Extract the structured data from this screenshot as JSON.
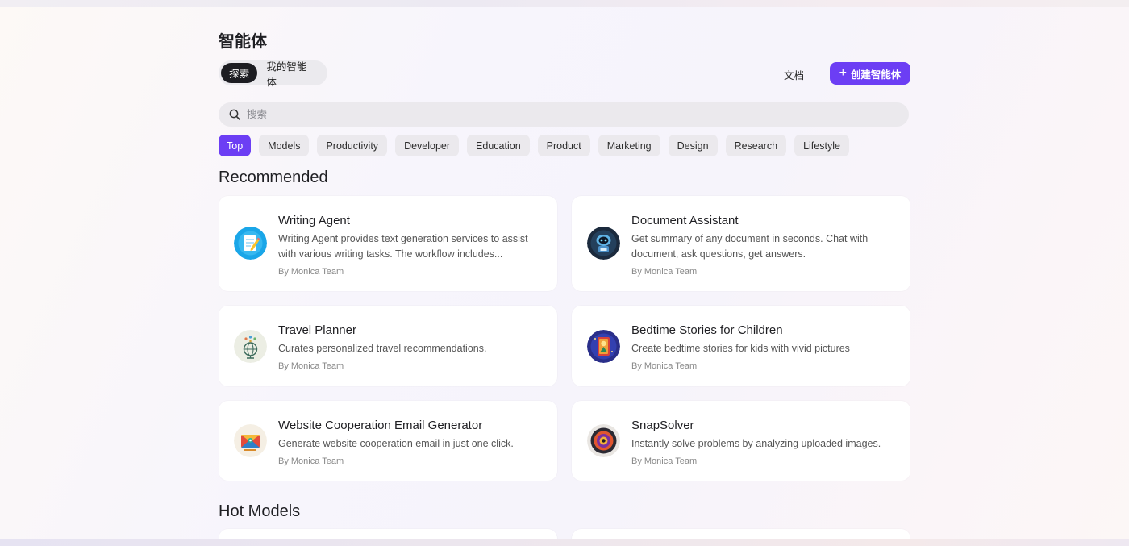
{
  "page": {
    "title": "智能体"
  },
  "tabs": {
    "explore": "探索",
    "mine": "我的智能体"
  },
  "header": {
    "docs": "文档",
    "create": "创建智能体",
    "create_icon": "plus-icon"
  },
  "search": {
    "placeholder": "搜索",
    "value": ""
  },
  "categories": [
    "Top",
    "Models",
    "Productivity",
    "Developer",
    "Education",
    "Product",
    "Marketing",
    "Design",
    "Research",
    "Lifestyle"
  ],
  "selected_category": "Top",
  "colors": {
    "accent": "#6c3ef4",
    "active_tab": "#1d1d22"
  },
  "recommended": {
    "title": "Recommended",
    "cards": [
      {
        "title": "Writing Agent",
        "desc1": "Writing Agent provides text generation services to assist",
        "desc2": "with various writing tasks. The workflow includes...",
        "by": "By Monica Team",
        "icon": "writing-pencil-icon"
      },
      {
        "title": "Document Assistant",
        "desc1": "Get summary of any document in seconds. Chat with",
        "desc2": "document, ask questions, get answers.",
        "by": "By Monica Team",
        "icon": "robot-document-icon"
      },
      {
        "title": "Travel Planner",
        "desc1": "Curates personalized travel recommendations.",
        "by": "By Monica Team",
        "icon": "globe-travel-icon"
      },
      {
        "title": "Bedtime Stories for Children",
        "desc1": "Create bedtime stories for kids with vivid pictures",
        "by": "By Monica Team",
        "icon": "storybook-icon"
      },
      {
        "title": "Website Cooperation Email Generator",
        "desc1": "Generate website cooperation email in just one click.",
        "by": "By Monica Team",
        "icon": "email-envelope-icon"
      },
      {
        "title": "SnapSolver",
        "desc1": "Instantly solve problems by analyzing uploaded images.",
        "by": "By Monica Team",
        "icon": "camera-lens-icon"
      }
    ]
  },
  "hot_models": {
    "title": "Hot Models"
  }
}
